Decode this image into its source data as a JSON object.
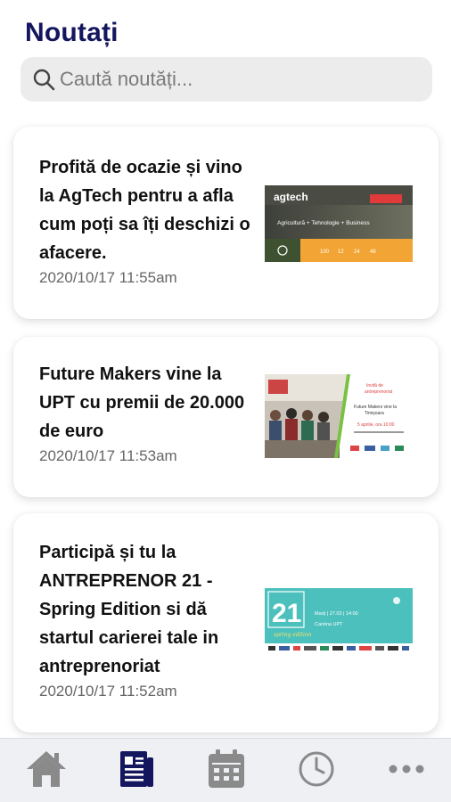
{
  "header": {
    "title": "Noutați"
  },
  "search": {
    "placeholder": "Caută noutăți..."
  },
  "news": [
    {
      "title": "Profită de ocazie și vino la AgTech pentru a afla cum poți sa îți deschizi o afacere.",
      "date": "2020/10/17 11:55am",
      "thumb": {
        "logo": "agtech",
        "tagline": "Agricultură + Tehnologie + Business",
        "stats": [
          "100",
          "12",
          "24",
          "48"
        ]
      }
    },
    {
      "title": "Future Makers vine la UPT cu premii de 20.000 de euro",
      "date": "2020/10/17 11:53am",
      "thumb": {
        "lines": [
          "Invită de",
          "antreprenoriat",
          "Future Makers vine la",
          "Timișoara",
          "5 aprilie, ora 10:00"
        ]
      }
    },
    {
      "title": "Participă și tu la ANTREPRENOR 21 - Spring Edition si dă startul carierei tale in antreprenoriat",
      "date": "2020/10/17 11:52am",
      "thumb": {
        "number": "21",
        "caption": "spring edition",
        "when": "Marți | 27.03 | 14:00",
        "where": "Cantina UPT"
      }
    }
  ],
  "nav": {
    "items": [
      {
        "name": "home",
        "icon": "home-icon",
        "active": false
      },
      {
        "name": "news",
        "icon": "news-icon",
        "active": true
      },
      {
        "name": "calendar",
        "icon": "calendar-icon",
        "active": false
      },
      {
        "name": "history",
        "icon": "clock-icon",
        "active": false
      },
      {
        "name": "more",
        "icon": "more-icon",
        "active": false
      }
    ]
  },
  "colors": {
    "title": "#14165e",
    "nav_active": "#14165e",
    "nav_inactive": "#8a8a8a"
  }
}
